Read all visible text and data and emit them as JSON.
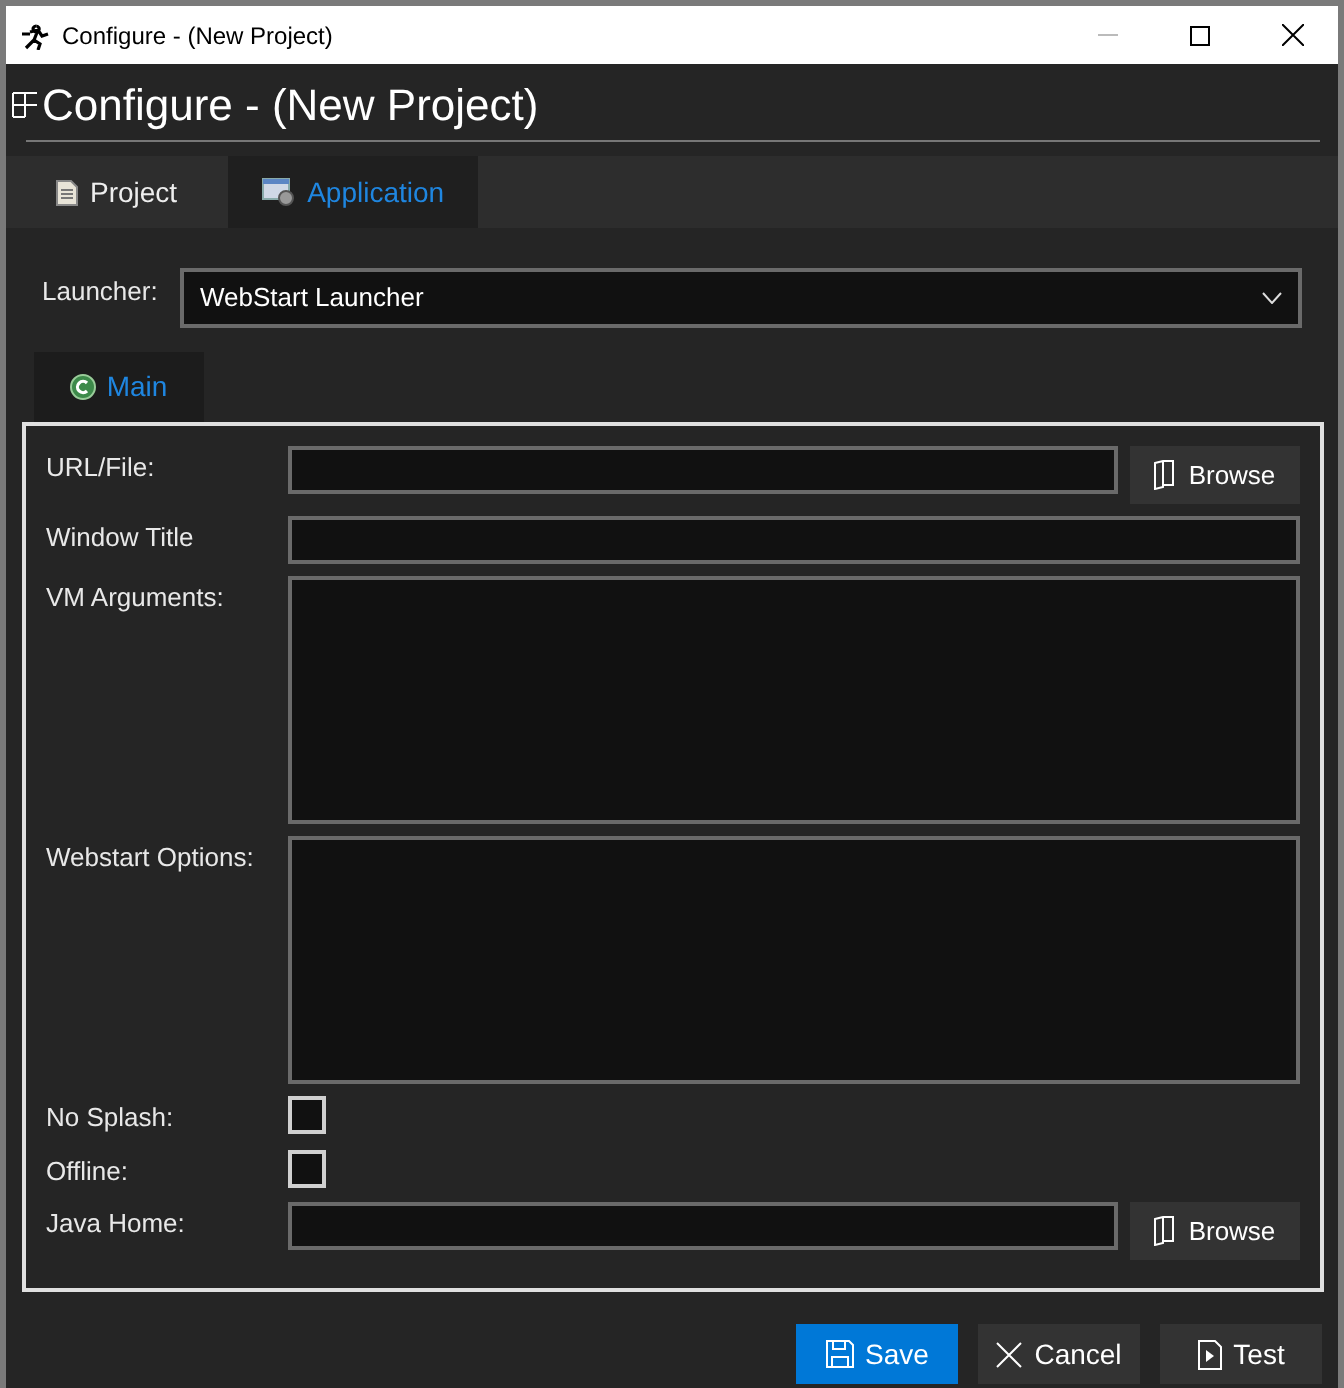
{
  "window": {
    "title": "Configure - (New Project)"
  },
  "header": {
    "title": "Configure - (New Project)"
  },
  "tabs": [
    {
      "label": "Project",
      "selected": false
    },
    {
      "label": "Application",
      "selected": true
    }
  ],
  "launcher": {
    "label": "Launcher:",
    "value": "WebStart Launcher"
  },
  "sub_tabs": [
    {
      "label": "Main",
      "selected": true
    }
  ],
  "fields": [
    {
      "kind": "browse",
      "label": "URL/File:",
      "button": "Browse"
    },
    {
      "kind": "text",
      "label": "Window Title"
    },
    {
      "kind": "area",
      "label": "VM Arguments:"
    },
    {
      "kind": "area",
      "label": "Webstart Options:"
    },
    {
      "kind": "checkbox",
      "label": "No Splash:",
      "checked": false
    },
    {
      "kind": "checkbox",
      "label": "Offline:",
      "checked": false
    },
    {
      "kind": "browse",
      "label": "Java Home:",
      "button": "Browse"
    }
  ],
  "buttons": [
    {
      "label": "Save",
      "kind": "primary"
    },
    {
      "label": "Cancel",
      "kind": "normal"
    },
    {
      "label": "Test",
      "kind": "normal"
    }
  ]
}
